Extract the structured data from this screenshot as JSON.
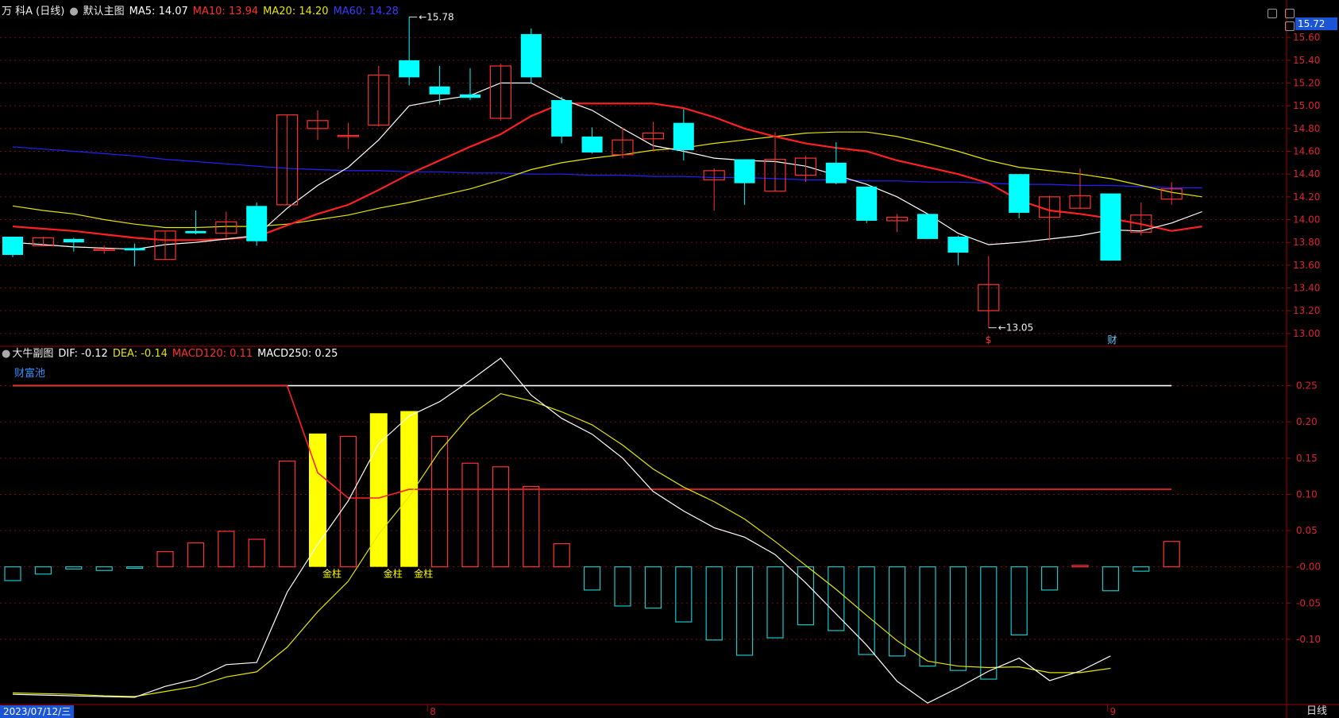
{
  "main_header": {
    "stock_name": "万 科A (日线)",
    "panel_name": "默认主图",
    "ma5": "MA5: 14.07",
    "ma10": "MA10: 13.94",
    "ma20": "MA20: 14.20",
    "ma60": "MA60: 14.28"
  },
  "sub_header": {
    "panel_name": "大牛副图",
    "dif": "DIF: -0.12",
    "dea": "DEA: -0.14",
    "macd120": "MACD120: 0.11",
    "macd250": "MACD250: 0.25",
    "label": "财富池"
  },
  "colors": {
    "up": "#ff3232",
    "down": "#00ffff",
    "ma5": "#ffffff",
    "ma10": "#ff2020",
    "ma20": "#e6e600",
    "ma60": "#2222ff",
    "golden": "#ffff00"
  },
  "current_price": "15.72",
  "footer": {
    "date": "2023/07/12/三",
    "month_8": "8",
    "month_9": "9",
    "mode": "日线"
  },
  "chart_data": [
    {
      "type": "candlestick",
      "ylim": [
        12.95,
        15.72
      ],
      "yticks": [
        "15.60",
        "15.40",
        "15.20",
        "15.00",
        "14.80",
        "14.60",
        "14.40",
        "14.20",
        "14.00",
        "13.80",
        "13.60",
        "13.40",
        "13.20",
        "13.00"
      ],
      "annotations": [
        {
          "text": "15.78",
          "index": 13
        },
        {
          "text": "13.05",
          "index": 32
        }
      ],
      "markers": [
        {
          "text": "$",
          "index": 32
        },
        {
          "text": "财",
          "index": 36
        }
      ],
      "candles": [
        {
          "o": 13.85,
          "c": 13.69,
          "h": 13.85,
          "l": 13.67
        },
        {
          "o": 13.77,
          "c": 13.84,
          "h": 13.85,
          "l": 13.77
        },
        {
          "o": 13.83,
          "c": 13.8,
          "h": 13.84,
          "l": 13.72
        },
        {
          "o": 13.74,
          "c": 13.74,
          "h": 13.77,
          "l": 13.7
        },
        {
          "o": 13.75,
          "c": 13.73,
          "h": 13.79,
          "l": 13.59
        },
        {
          "o": 13.65,
          "c": 13.9,
          "h": 13.9,
          "l": 13.65
        },
        {
          "o": 13.9,
          "c": 13.88,
          "h": 14.08,
          "l": 13.87
        },
        {
          "o": 13.88,
          "c": 13.98,
          "h": 14.07,
          "l": 13.84
        },
        {
          "o": 14.12,
          "c": 13.81,
          "h": 14.15,
          "l": 13.77
        },
        {
          "o": 14.13,
          "c": 14.92,
          "h": 14.92,
          "l": 14.13
        },
        {
          "o": 14.8,
          "c": 14.87,
          "h": 14.96,
          "l": 14.7
        },
        {
          "o": 14.74,
          "c": 14.74,
          "h": 14.85,
          "l": 14.62
        },
        {
          "o": 14.83,
          "c": 15.27,
          "h": 15.35,
          "l": 14.82
        },
        {
          "o": 15.4,
          "c": 15.25,
          "h": 15.78,
          "l": 15.18
        },
        {
          "o": 15.17,
          "c": 15.1,
          "h": 15.35,
          "l": 15.01
        },
        {
          "o": 15.1,
          "c": 15.07,
          "h": 15.33,
          "l": 15.05
        },
        {
          "o": 14.89,
          "c": 15.35,
          "h": 15.37,
          "l": 14.87
        },
        {
          "o": 15.63,
          "c": 15.25,
          "h": 15.68,
          "l": 15.2
        },
        {
          "o": 15.05,
          "c": 14.73,
          "h": 15.08,
          "l": 14.67
        },
        {
          "o": 14.73,
          "c": 14.59,
          "h": 14.81,
          "l": 14.58
        },
        {
          "o": 14.57,
          "c": 14.7,
          "h": 14.81,
          "l": 14.54
        },
        {
          "o": 14.71,
          "c": 14.76,
          "h": 14.86,
          "l": 14.6
        },
        {
          "o": 14.85,
          "c": 14.61,
          "h": 14.97,
          "l": 14.52
        },
        {
          "o": 14.35,
          "c": 14.43,
          "h": 14.45,
          "l": 14.08
        },
        {
          "o": 14.53,
          "c": 14.32,
          "h": 14.53,
          "l": 14.13
        },
        {
          "o": 14.25,
          "c": 14.53,
          "h": 14.77,
          "l": 14.25
        },
        {
          "o": 14.39,
          "c": 14.54,
          "h": 14.56,
          "l": 14.33
        },
        {
          "o": 14.5,
          "c": 14.32,
          "h": 14.68,
          "l": 14.31
        },
        {
          "o": 14.29,
          "c": 13.99,
          "h": 14.29,
          "l": 13.97
        },
        {
          "o": 13.99,
          "c": 14.02,
          "h": 14.05,
          "l": 13.89
        },
        {
          "o": 14.05,
          "c": 13.83,
          "h": 14.05,
          "l": 13.83
        },
        {
          "o": 13.85,
          "c": 13.71,
          "h": 13.86,
          "l": 13.6
        },
        {
          "o": 13.2,
          "c": 13.43,
          "h": 13.68,
          "l": 13.05
        },
        {
          "o": 14.4,
          "c": 14.06,
          "h": 14.4,
          "l": 14.01
        },
        {
          "o": 14.02,
          "c": 14.2,
          "h": 14.21,
          "l": 13.82
        },
        {
          "o": 14.1,
          "c": 14.21,
          "h": 14.45,
          "l": 14.1
        },
        {
          "o": 14.23,
          "c": 13.64,
          "h": 14.23,
          "l": 13.64
        },
        {
          "o": 13.89,
          "c": 14.04,
          "h": 14.15,
          "l": 13.86
        },
        {
          "o": 14.18,
          "c": 14.27,
          "h": 14.33,
          "l": 14.13
        }
      ],
      "ma5": [
        13.8,
        13.78,
        13.76,
        13.75,
        13.74,
        13.78,
        13.8,
        13.83,
        13.86,
        14.1,
        14.3,
        14.46,
        14.7,
        15.0,
        15.05,
        15.09,
        15.2,
        15.2,
        15.06,
        14.96,
        14.8,
        14.65,
        14.6,
        14.54,
        14.52,
        14.51,
        14.47,
        14.39,
        14.31,
        14.2,
        14.05,
        13.88,
        13.78,
        13.8,
        13.83,
        13.86,
        13.91,
        13.9,
        13.97,
        14.07
      ],
      "ma10": [
        13.94,
        13.92,
        13.9,
        13.87,
        13.84,
        13.82,
        13.82,
        13.83,
        13.85,
        13.95,
        14.05,
        14.13,
        14.26,
        14.4,
        14.52,
        14.64,
        14.75,
        14.91,
        15.02,
        15.02,
        15.02,
        15.02,
        14.98,
        14.9,
        14.8,
        14.73,
        14.67,
        14.63,
        14.6,
        14.52,
        14.46,
        14.4,
        14.32,
        14.17,
        14.08,
        14.05,
        14.01,
        13.96,
        13.9,
        13.94
      ],
      "ma20": [
        14.12,
        14.08,
        14.05,
        14.0,
        13.96,
        13.93,
        13.93,
        13.94,
        13.94,
        13.96,
        14.0,
        14.04,
        14.1,
        14.15,
        14.21,
        14.27,
        14.35,
        14.44,
        14.5,
        14.54,
        14.57,
        14.61,
        14.63,
        14.67,
        14.7,
        14.73,
        14.76,
        14.77,
        14.77,
        14.73,
        14.67,
        14.6,
        14.52,
        14.46,
        14.43,
        14.4,
        14.36,
        14.3,
        14.24,
        14.2
      ],
      "ma60": [
        14.64,
        14.62,
        14.6,
        14.58,
        14.56,
        14.53,
        14.51,
        14.49,
        14.47,
        14.45,
        14.44,
        14.43,
        14.43,
        14.42,
        14.42,
        14.41,
        14.41,
        14.4,
        14.4,
        14.39,
        14.39,
        14.38,
        14.38,
        14.37,
        14.37,
        14.36,
        14.35,
        14.35,
        14.34,
        14.34,
        14.33,
        14.33,
        14.32,
        14.31,
        14.31,
        14.3,
        14.3,
        14.29,
        14.28,
        14.28
      ]
    },
    {
      "type": "macd",
      "ylim": [
        -0.19,
        0.3
      ],
      "yticks": [
        "0.25",
        "0.20",
        "0.15",
        "0.10",
        "0.05",
        "-0.00",
        "-0.05",
        "-0.10"
      ],
      "macd250": 0.25,
      "macd120": [
        0.25,
        0.25,
        0.25,
        0.25,
        0.25,
        0.25,
        0.25,
        0.25,
        0.25,
        0.25,
        0.13,
        0.095,
        0.095,
        0.107,
        0.107,
        0.107,
        0.107,
        0.107,
        0.107,
        0.107,
        0.107,
        0.107,
        0.107,
        0.107,
        0.107,
        0.107,
        0.107,
        0.107,
        0.107,
        0.107,
        0.107,
        0.107,
        0.107,
        0.107,
        0.107,
        0.107,
        0.107,
        0.107,
        0.107
      ],
      "histogram": [
        -0.019,
        -0.01,
        -0.003,
        -0.005,
        -0.002,
        0.021,
        0.033,
        0.049,
        0.038,
        0.146,
        0.184,
        0.18,
        0.212,
        0.215,
        0.18,
        0.143,
        0.138,
        0.111,
        0.032,
        -0.032,
        -0.054,
        -0.057,
        -0.076,
        -0.101,
        -0.122,
        -0.098,
        -0.08,
        -0.088,
        -0.121,
        -0.123,
        -0.137,
        -0.143,
        -0.155,
        -0.094,
        -0.032,
        0.002,
        -0.033,
        -0.006,
        0.035
      ],
      "golden_bars": [
        10,
        12,
        13
      ],
      "golden_label": "金柱",
      "dif": [
        -0.176,
        -0.177,
        -0.178,
        -0.179,
        -0.18,
        -0.165,
        -0.155,
        -0.135,
        -0.132,
        -0.035,
        0.031,
        0.091,
        0.17,
        0.208,
        0.228,
        0.257,
        0.288,
        0.237,
        0.205,
        0.183,
        0.15,
        0.104,
        0.077,
        0.054,
        0.041,
        0.017,
        -0.022,
        -0.065,
        -0.108,
        -0.158,
        -0.188,
        -0.167,
        -0.144,
        -0.126,
        -0.157,
        -0.144,
        -0.123
      ],
      "dea": [
        -0.174,
        -0.175,
        -0.176,
        -0.178,
        -0.179,
        -0.172,
        -0.165,
        -0.152,
        -0.145,
        -0.111,
        -0.062,
        -0.02,
        0.045,
        0.097,
        0.16,
        0.209,
        0.239,
        0.229,
        0.214,
        0.196,
        0.168,
        0.135,
        0.11,
        0.09,
        0.066,
        0.035,
        0.002,
        -0.031,
        -0.067,
        -0.102,
        -0.13,
        -0.137,
        -0.139,
        -0.138,
        -0.146,
        -0.146,
        -0.14
      ]
    }
  ]
}
